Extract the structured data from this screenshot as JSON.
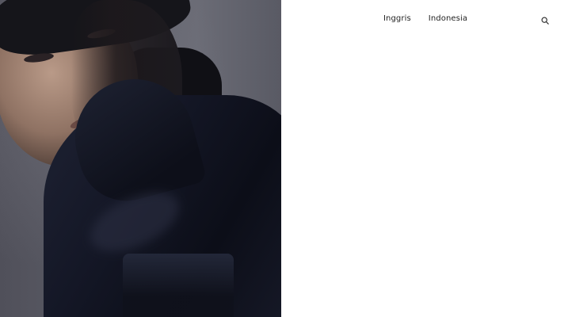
{
  "header": {
    "languages": [
      {
        "label": "Inggris"
      },
      {
        "label": "Indonesia"
      }
    ],
    "search_icon": "search-icon"
  },
  "hero": {
    "image_icon": "fashion-portrait-image"
  },
  "colors": {
    "text": "#222222",
    "background": "#ffffff",
    "photo_dark": "#0c0e18"
  }
}
